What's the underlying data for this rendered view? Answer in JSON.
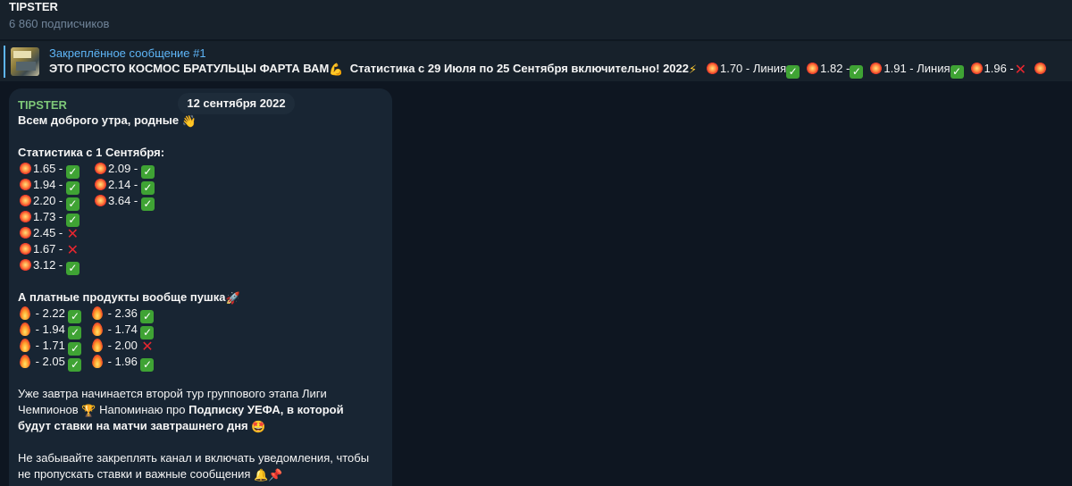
{
  "channel": {
    "title": "TIPSTER",
    "subscribers": "6 860 подписчиков"
  },
  "pinned": {
    "label": "Закреплённое сообщение #1",
    "text_start": "ЭТО ПРОСТО КОСМОС БРАТУЛЬЦЫ ФАРТА ВАМ",
    "text_stat": "Статистика с 29 Июля по 25  Сентября включительно! 2022",
    "items": [
      {
        "value": "1.70 - Линия",
        "result": "win"
      },
      {
        "value": "1.82 -",
        "result": "win"
      },
      {
        "value": "1.91 - Линия",
        "result": "win"
      },
      {
        "value": "1.96 -",
        "result": "loss"
      }
    ]
  },
  "message": {
    "sender": "TIPSTER",
    "date": "12 сентября 2022",
    "greeting": "Всем доброго утра, родные",
    "stats_heading": "Статистика с 1 Сентября:",
    "stats_col1": [
      {
        "value": "1.65 -",
        "result": "win"
      },
      {
        "value": "1.94 -",
        "result": "win"
      },
      {
        "value": "2.20 -",
        "result": "win"
      },
      {
        "value": "1.73 -",
        "result": "win"
      },
      {
        "value": "2.45 -",
        "result": "loss"
      },
      {
        "value": "1.67 -",
        "result": "loss"
      },
      {
        "value": "3.12 -",
        "result": "win"
      }
    ],
    "stats_col2": [
      {
        "value": "2.09 -",
        "result": "win"
      },
      {
        "value": "2.14 -",
        "result": "win"
      },
      {
        "value": "3.64 -",
        "result": "win"
      }
    ],
    "paid_heading": "А платные продукты вообще пушка",
    "paid_col1": [
      {
        "value": " - 2.22",
        "result": "win"
      },
      {
        "value": " - 1.94",
        "result": "win"
      },
      {
        "value": " - 1.71",
        "result": "win"
      },
      {
        "value": " - 2.05",
        "result": "win"
      }
    ],
    "paid_col2": [
      {
        "value": " - 2.36",
        "result": "win"
      },
      {
        "value": " - 1.74",
        "result": "win"
      },
      {
        "value": " - 2.00",
        "result": "loss"
      },
      {
        "value": " - 1.96",
        "result": "win"
      }
    ],
    "para1_line1": "Уже завтра начинается второй тур группового этапа Лиги",
    "para1_line2_a": "Чемпионов",
    "para1_line2_b": " Напоминаю про ",
    "para1_line2_bold": "Подписку УЕФА, в которой",
    "para1_line3_bold": "будут ставки на матчи завтрашнего дня",
    "para2_line1": "Не забывайте закреплять канал и включать уведомления, чтобы",
    "para2_line2": "не пропускать ставки и важные сообщения"
  }
}
